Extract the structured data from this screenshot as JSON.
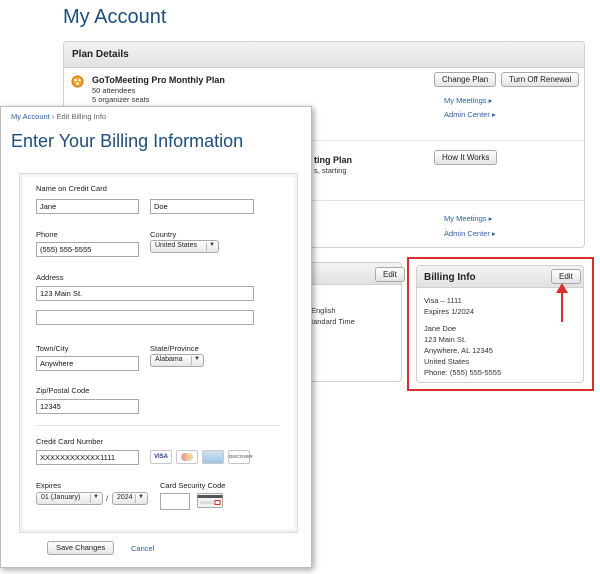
{
  "back": {
    "title": "My Account",
    "plan_details": {
      "header": "Plan Details",
      "plan1": {
        "name": "GoToMeeting Pro Monthly Plan",
        "attendees": "50 attendees",
        "seats": "5 organizer seats",
        "change_plan": "Change Plan",
        "turn_off_renewal": "Turn Off Renewal",
        "my_meetings": "My Meetings",
        "admin_center": "Admin Center"
      },
      "plan2": {
        "name_partial": "ting Plan",
        "sub_partial": "s, starting",
        "how_it_works": "How It Works"
      },
      "plan3": {
        "my_meetings": "My Meetings",
        "admin_center": "Admin Center"
      }
    },
    "preferences": {
      "edit": "Edit",
      "language_partial": "English",
      "timezone_partial": "tandard Time"
    },
    "billing_info": {
      "header": "Billing Info",
      "edit": "Edit",
      "card": "Visa – 1111",
      "expires": "Expires 1/2024",
      "name": "Jane Doe",
      "street": "123 Main St.",
      "city_state": "Anywhere, AL 12345",
      "country": "United States",
      "phone": "Phone: (555) 555-5555"
    },
    "colors": {
      "highlight": "#d9302b",
      "title": "#1f4e7a",
      "link": "#2f62a3"
    }
  },
  "front": {
    "breadcrumb": {
      "home": "My Account",
      "separator": "›",
      "current": "Edit Billing Info"
    },
    "title": "Enter Your Billing Information",
    "form": {
      "name_label": "Name on Credit Card",
      "first_name": "Jane",
      "last_name": "Doe",
      "phone_label": "Phone",
      "phone": "(555) 555-5555",
      "country_label": "Country",
      "country": "United States",
      "address_label": "Address",
      "address1": "123 Main St.",
      "address2": "",
      "city_label": "Town/City",
      "city": "Anywhere",
      "state_label": "State/Province",
      "state": "Alabama",
      "zip_label": "Zip/Postal Code",
      "zip": "12345",
      "cc_label": "Credit Card Number",
      "cc_number": "XXXXXXXXXXXX1111",
      "cards": {
        "visa": "VISA",
        "mastercard": "MC",
        "amex": "AMEX",
        "discover": "DISCOVER"
      },
      "expires_label": "Expires",
      "exp_month": "01 (January)",
      "exp_sep": "/",
      "exp_year": "2024",
      "csc_label": "Card Security Code",
      "csc": ""
    },
    "save": "Save Changes",
    "cancel": "Cancel"
  }
}
